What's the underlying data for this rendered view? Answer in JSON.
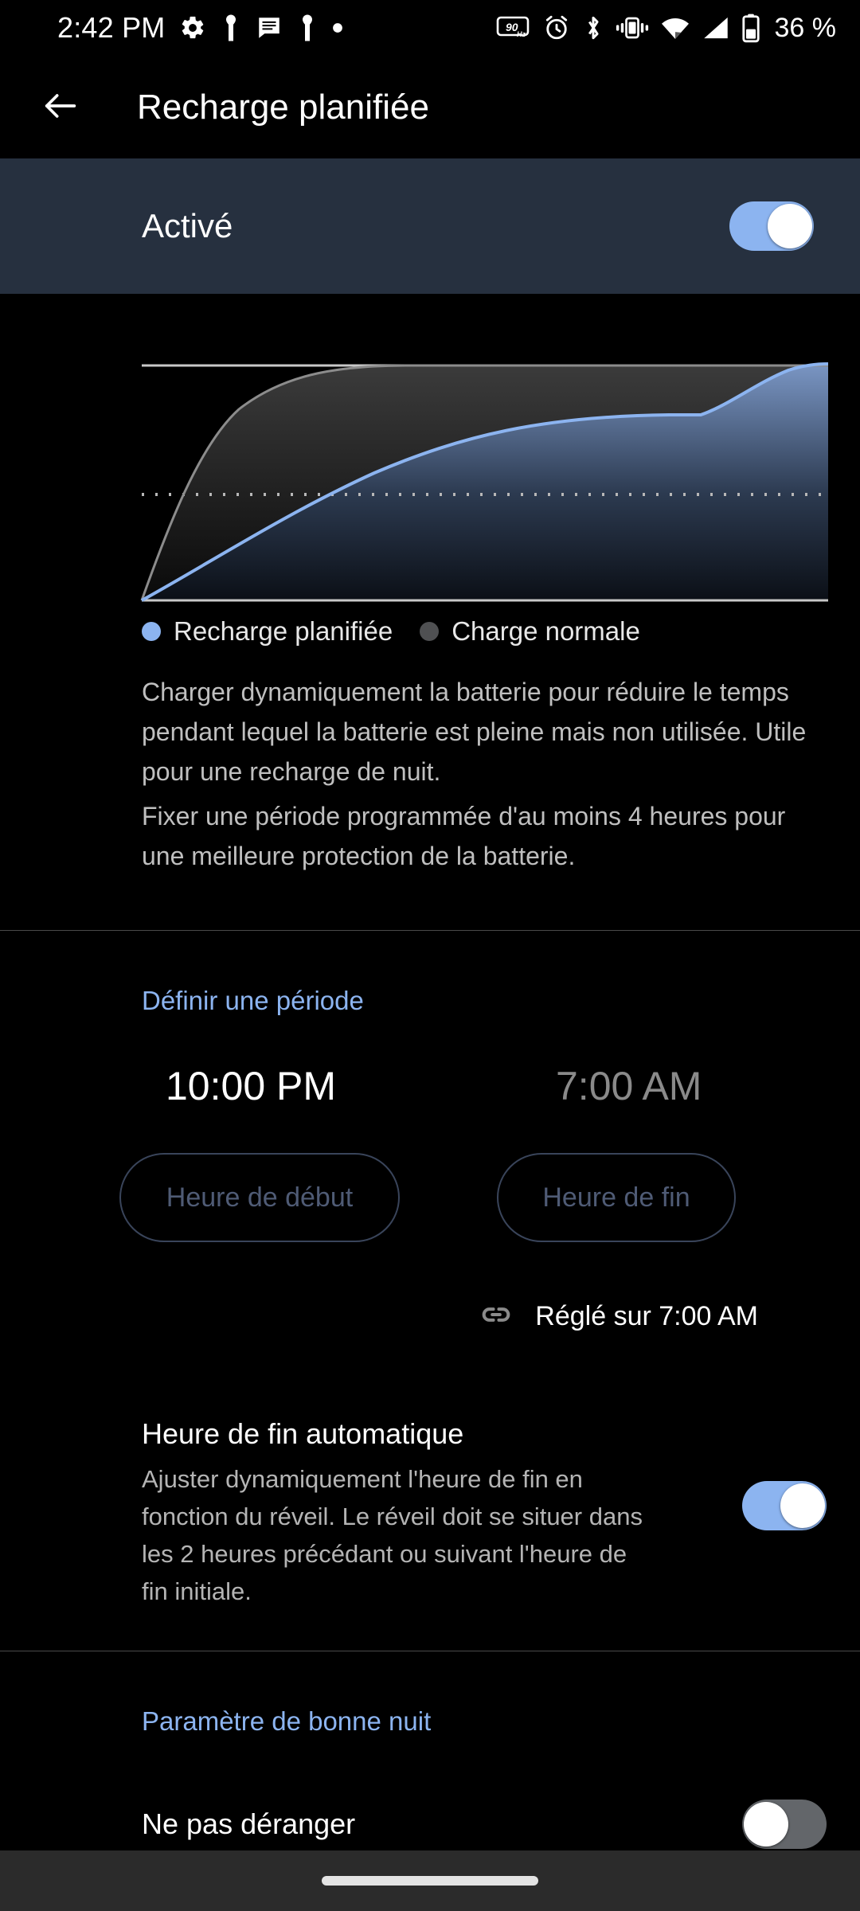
{
  "status_bar": {
    "time": "2:42 PM",
    "battery_percent": "36 %",
    "left_icons": [
      "gear-icon",
      "person-notification-icon",
      "message-icon",
      "person-notification-icon",
      "dot-icon"
    ],
    "right_icons": [
      "refresh-rate-90hz-icon",
      "alarm-icon",
      "bluetooth-icon",
      "vibrate-icon",
      "wifi-icon",
      "cellular-signal-icon",
      "battery-icon"
    ],
    "refresh_rate": "90 Hz"
  },
  "app_bar": {
    "back_label": "back-arrow",
    "title": "Recharge planifiée"
  },
  "master": {
    "label": "Activé",
    "enabled": true
  },
  "chart_data": {
    "type": "line",
    "title": "",
    "xlabel": "",
    "ylabel": "",
    "xlim": [
      0,
      100
    ],
    "ylim": [
      0,
      100
    ],
    "grid": false,
    "reference_line": {
      "value": 50,
      "style": "dotted",
      "color": "#b8b8b8"
    },
    "legend_position": "below",
    "series": [
      {
        "name": "Recharge planifiée",
        "color": "#8cb4f0",
        "x": [
          0,
          5,
          12,
          20,
          30,
          40,
          50,
          60,
          68,
          74,
          78,
          82,
          86,
          92,
          100
        ],
        "y": [
          0,
          9,
          22,
          34,
          47,
          57,
          65,
          72,
          77,
          79,
          80,
          80,
          92,
          97,
          100
        ]
      },
      {
        "name": "Charge normale",
        "color": "#8c8c8c",
        "x": [
          0,
          3,
          7,
          12,
          18,
          25,
          33,
          42,
          52,
          62,
          75,
          88,
          100
        ],
        "y": [
          0,
          22,
          44,
          63,
          78,
          88,
          94,
          97,
          99,
          100,
          100,
          100,
          100
        ]
      }
    ]
  },
  "legend": {
    "scheduled": "Recharge planifiée",
    "normal": "Charge normale"
  },
  "description": {
    "paragraph1": "Charger dynamiquement la batterie pour réduire le temps pendant lequel la batterie est pleine mais non utilisée. Utile pour une recharge de nuit.",
    "paragraph2": "Fixer une période programmée d'au moins 4 heures pour une meilleure protection de la batterie."
  },
  "period": {
    "header": "Définir une période",
    "start_time": "10:00 PM",
    "end_time": "7:00 AM",
    "start_button": "Heure de début",
    "end_button": "Heure de fin",
    "linked_text": "Réglé sur 7:00 AM",
    "link_icon": "link-icon"
  },
  "auto_end": {
    "title": "Heure de fin automatique",
    "description": "Ajuster dynamiquement l'heure de fin en fonction du réveil. Le réveil doit se situer dans les 2 heures précédant ou suivant l'heure de fin initiale.",
    "enabled": true
  },
  "goodnight": {
    "header": "Paramètre de bonne nuit",
    "dnd_label": "Ne pas déranger",
    "dnd_enabled": false
  },
  "colors": {
    "accent": "#8cb4f0",
    "band_background": "#26303f",
    "page_background": "#000000",
    "switch_off_track": "#63666a",
    "nav_bar": "#2b2b2b"
  }
}
